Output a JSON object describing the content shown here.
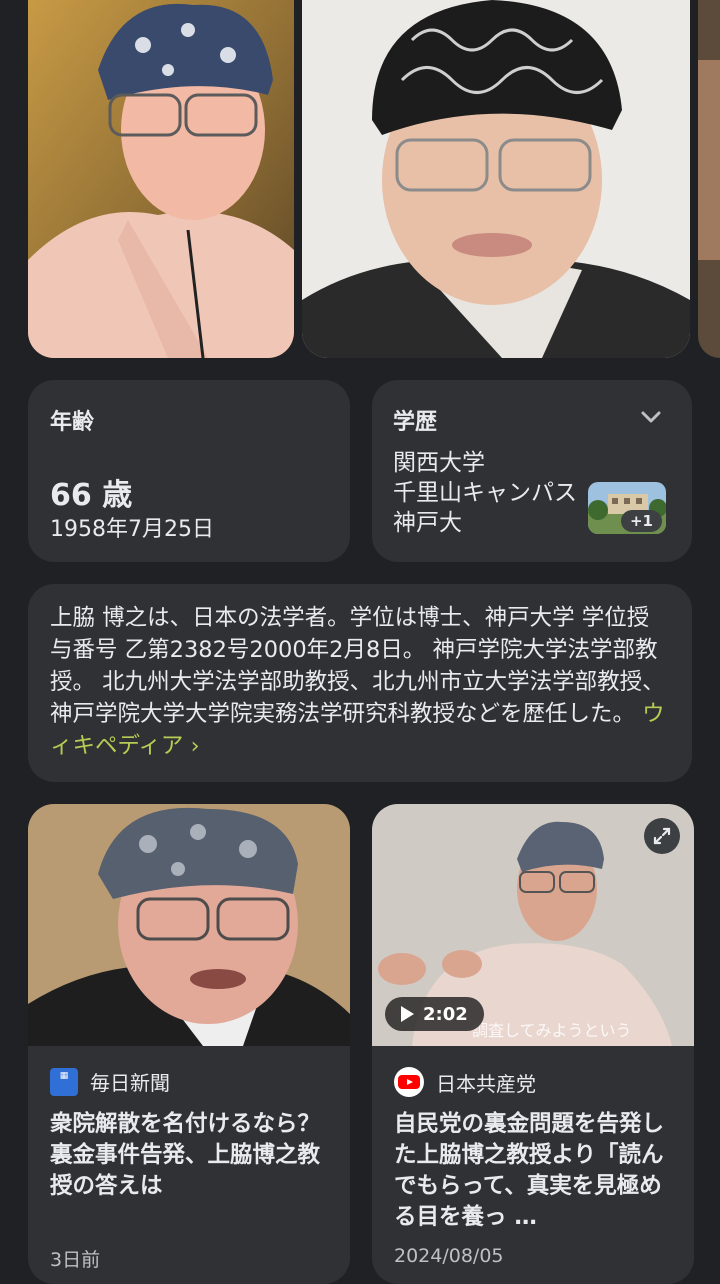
{
  "facts": {
    "age": {
      "title": "年齢",
      "value": "66 歳",
      "birthdate": "1958年7月25日"
    },
    "education": {
      "title": "学歴",
      "lines": [
        "関西大学",
        "千里山キャンパス",
        "神戸大"
      ],
      "more_badge": "+1"
    }
  },
  "description": {
    "text": "上脇 博之は、日本の法学者。学位は博士、神戸大学 学位授与番号 乙第2382号2000年2月8日。 神戸学院大学法学部教授。 北九州大学法学部助教授、北九州市立大学法学部教授、神戸学院大学大学院実務法学研究科教授などを歴任した。",
    "link_label": "ウィキペディア ›"
  },
  "news": [
    {
      "source": "毎日新聞",
      "source_icon": "mainichi-logo-icon",
      "headline": "衆院解散を名付けるなら？裏金事件告発、上脇博之教授の答えは",
      "date": "3日前"
    },
    {
      "source": "日本共産党",
      "source_icon": "youtube-logo-icon",
      "headline": "自民党の裏金問題を告発した上脇博之教授より「読んでもらって、真実を見極める目を養っ …",
      "date": "2024/08/05",
      "duration": "2:02",
      "video_caption": "調査してみようという"
    }
  ],
  "colors": {
    "background": "#202124",
    "card": "#303134",
    "link": "#b5cc54"
  }
}
